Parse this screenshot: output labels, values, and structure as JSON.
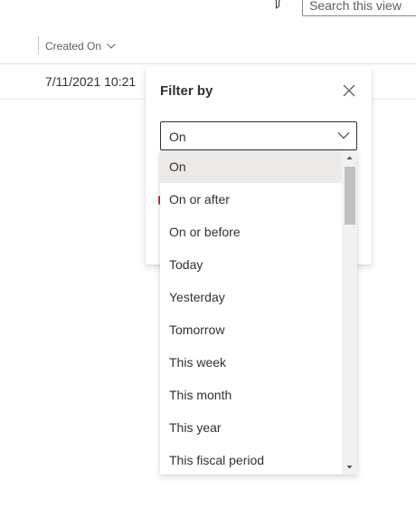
{
  "toolbar": {
    "filter_icon": "filter-icon",
    "search_placeholder": "Search this view"
  },
  "grid": {
    "column_header": "Created On",
    "rows": [
      {
        "created_on": "7/11/2021 10:21"
      }
    ]
  },
  "filter_panel": {
    "title": "Filter by",
    "close_icon": "close-icon",
    "operator_selected": "On",
    "operator_options": [
      "On",
      "On or after",
      "On or before",
      "Today",
      "Yesterday",
      "Tomorrow",
      "This week",
      "This month",
      "This year",
      "This fiscal period"
    ]
  },
  "colors": {
    "selected_option_bg": "#edebe9",
    "scroll_thumb": "#c1c1c1",
    "error_accent": "#d13438"
  }
}
